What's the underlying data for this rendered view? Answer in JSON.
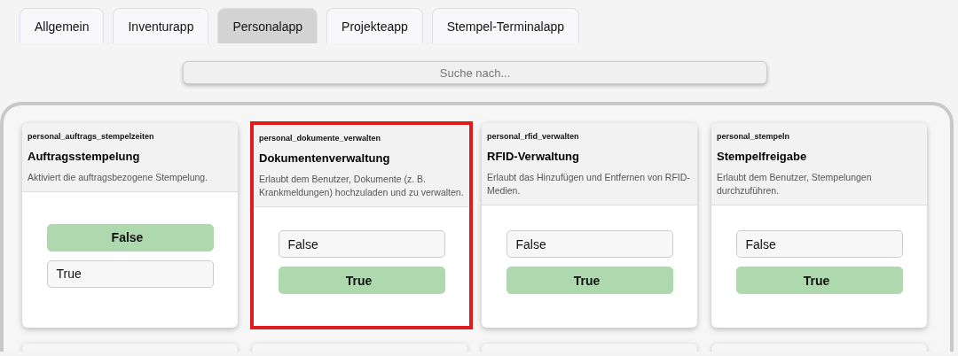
{
  "tabs": [
    {
      "label": "Allgemein",
      "selected": false
    },
    {
      "label": "Inventurapp",
      "selected": false
    },
    {
      "label": "Personalapp",
      "selected": true
    },
    {
      "label": "Projekteapp",
      "selected": false
    },
    {
      "label": "Stempel-Terminalapp",
      "selected": false
    }
  ],
  "search": {
    "placeholder": "Suche nach..."
  },
  "cards": [
    {
      "key": "personal_auftrags_stempelzeiten",
      "title": "Auftragsstempelung",
      "description": "Aktiviert die auftragsbezogene Stempelung.",
      "highlighted": false,
      "options": [
        {
          "label": "False",
          "selected": true
        },
        {
          "label": "True",
          "selected": false
        }
      ]
    },
    {
      "key": "personal_dokumente_verwalten",
      "title": "Dokumentenverwaltung",
      "description": "Erlaubt dem Benutzer, Dokumente (z. B. Krankmeldungen) hochzuladen und zu verwalten.",
      "highlighted": true,
      "options": [
        {
          "label": "False",
          "selected": false
        },
        {
          "label": "True",
          "selected": true
        }
      ]
    },
    {
      "key": "personal_rfid_verwalten",
      "title": "RFID-Verwaltung",
      "description": "Erlaubt das Hinzufügen und Entfernen von RFID-Medien.",
      "highlighted": false,
      "options": [
        {
          "label": "False",
          "selected": false
        },
        {
          "label": "True",
          "selected": true
        }
      ]
    },
    {
      "key": "personal_stempeln",
      "title": "Stempelfreigabe",
      "description": "Erlaubt dem Benutzer, Stempelungen durchzuführen.",
      "highlighted": false,
      "options": [
        {
          "label": "False",
          "selected": false
        },
        {
          "label": "True",
          "selected": true
        }
      ]
    }
  ]
}
